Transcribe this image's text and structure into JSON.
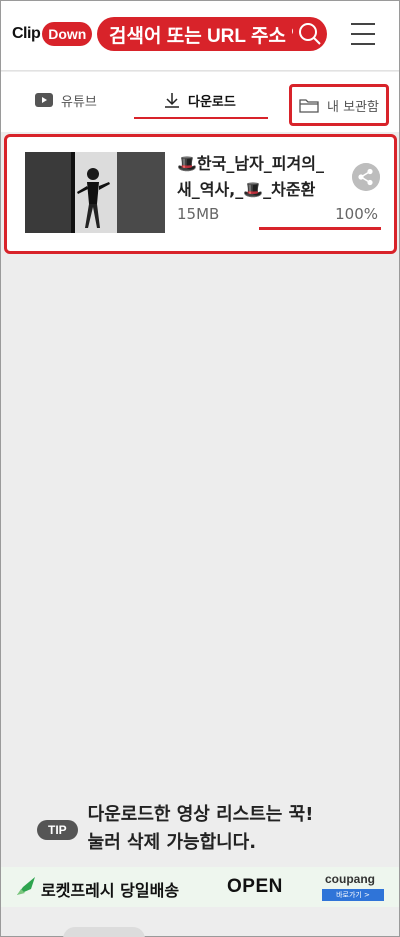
{
  "header": {
    "logo_clip": "Clip",
    "logo_down": "Down",
    "search_text": "검색어 또는 URL 주소 입력"
  },
  "tabs": [
    {
      "label": "유튜브",
      "icon": "youtube-icon"
    },
    {
      "label": "다운로드",
      "icon": "download-icon",
      "active": true
    },
    {
      "label": "내 보관함",
      "icon": "folder-icon"
    }
  ],
  "download_item": {
    "title": "🎩한국_남자_피겨의_새_역사,_🎩_차준환",
    "size": "15MB",
    "percent": "100%",
    "progress": 1.0
  },
  "tip": {
    "badge": "TIP",
    "line1": "다운로드한 영상 리스트는 꾹!",
    "line2": "눌러 삭제 가능합니다."
  },
  "ad": {
    "text": "로켓프레시 당일배송",
    "open": "OPEN",
    "brand": "coupang",
    "cta": "바로가기 >"
  },
  "colors": {
    "accent": "#d8232a"
  }
}
